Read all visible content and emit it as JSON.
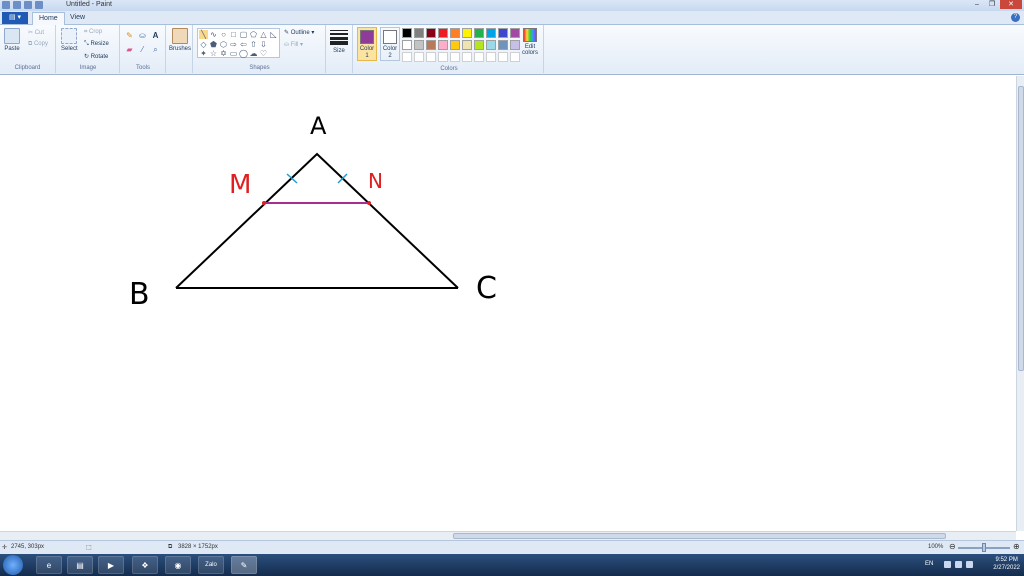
{
  "window": {
    "title": "Untitled - Paint"
  },
  "tabs": {
    "file": "▤ ▾",
    "home": "Home",
    "view": "View"
  },
  "help_label": "?",
  "clipboard": {
    "paste": "Paste",
    "cut": "Cut",
    "copy": "Copy",
    "label": "Clipboard"
  },
  "image": {
    "select": "Select",
    "crop": "Crop",
    "resize": "Resize",
    "rotate": "Rotate",
    "label": "Image"
  },
  "tools": {
    "label": "Tools"
  },
  "brushes": {
    "label": "Brushes"
  },
  "shapes": {
    "outline": "Outline",
    "fill": "Fill",
    "label": "Shapes"
  },
  "size": {
    "label": "Size"
  },
  "colors": {
    "color1_label": "Color 1",
    "color2_label": "Color 2",
    "edit_label": "Edit colors",
    "group_label": "Colors",
    "color1": "#8e3b9a",
    "color2": "#ffffff",
    "palette": [
      "#000000",
      "#7f7f7f",
      "#880015",
      "#ed1c24",
      "#ff7f27",
      "#fff200",
      "#22b14c",
      "#00a2e8",
      "#3f48cc",
      "#a349a4",
      "#ffffff",
      "#c3c3c3",
      "#b97a57",
      "#ffaec9",
      "#ffc90e",
      "#efe4b0",
      "#b5e61d",
      "#99d9ea",
      "#7092be",
      "#c8bfe7"
    ]
  },
  "drawing": {
    "label_a": "A",
    "label_b": "B",
    "label_c": "C",
    "label_m": "M",
    "label_n": "N",
    "triangle_color": "#000000",
    "label_color_mn": "#e02020",
    "tick_color": "#1a9fd6",
    "segment_color": "#a52f8f"
  },
  "status": {
    "cursor_pos": "2745, 303px",
    "image_size": "3828 × 1752px",
    "zoom": "100%"
  },
  "taskbar": {
    "lang": "EN",
    "time": "9:52 PM",
    "date": "2/27/2022",
    "zalo": "Zalo"
  }
}
